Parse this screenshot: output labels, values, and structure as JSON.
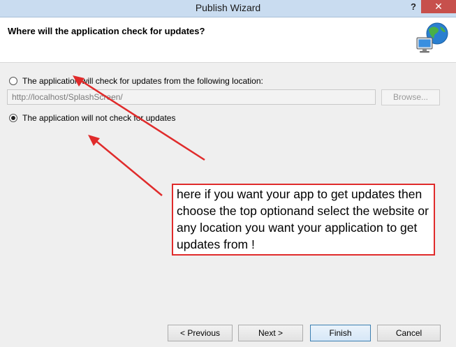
{
  "window": {
    "title": "Publish Wizard",
    "help_label": "?",
    "close_label": "✕"
  },
  "header": {
    "title": "Where will the application check for updates?",
    "icon": "globe-computer-icon"
  },
  "options": {
    "check_location_label": "The application will check for updates from the following location:",
    "check_location_selected": false,
    "location_value": "http://localhost/SplashScreen/",
    "browse_label": "Browse...",
    "no_check_label": "The application will not check for updates",
    "no_check_selected": true
  },
  "annotation": {
    "text": "here if you want your app to get updates then choose the top optionand select the website or any location you want your application to get updates from !",
    "color": "#e02b2b"
  },
  "footer": {
    "previous_label": "< Previous",
    "next_label": "Next >",
    "finish_label": "Finish",
    "cancel_label": "Cancel"
  }
}
